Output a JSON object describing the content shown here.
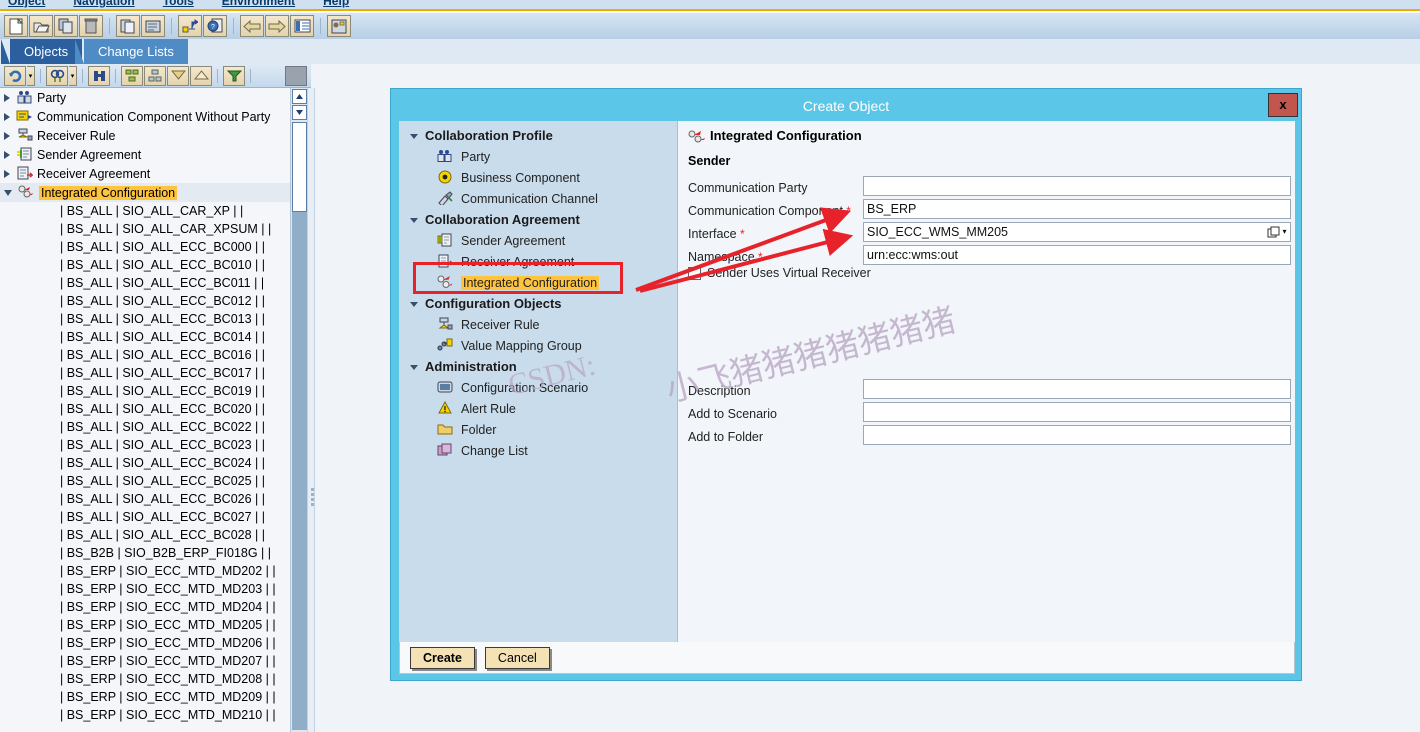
{
  "menu": {
    "items": [
      "Object",
      "Navigation",
      "Tools",
      "Environment",
      "Help"
    ]
  },
  "toolbar": {
    "icons": [
      "new-document-icon",
      "open-folder-icon",
      "copy-icon",
      "delete-trash-icon",
      "duplicate-icon",
      "properties-icon",
      "where-used-icon",
      "find-object-icon",
      "back-arrow-icon",
      "forward-arrow-icon",
      "list-view-icon",
      "user-admin-icon"
    ]
  },
  "tabs": {
    "objects": "Objects",
    "change_lists": "Change Lists"
  },
  "subtoolbar": {
    "icons": [
      "refresh-icon",
      "find-icon",
      "binoculars-icon",
      "expand-tree-icon",
      "collapse-tree-icon",
      "expand-all-icon",
      "collapse-all-icon",
      "filter-icon",
      "stop-icon"
    ]
  },
  "tree": {
    "roots": [
      {
        "label": "Party",
        "icon": "party-icon",
        "expanded": false,
        "highlighted": false
      },
      {
        "label": "Communication Component Without Party",
        "icon": "communication-component-icon",
        "expanded": false,
        "highlighted": false
      },
      {
        "label": "Receiver Rule",
        "icon": "receiver-rule-icon",
        "expanded": false,
        "highlighted": false
      },
      {
        "label": "Sender Agreement",
        "icon": "sender-agreement-icon",
        "expanded": false,
        "highlighted": false
      },
      {
        "label": "Receiver Agreement",
        "icon": "receiver-agreement-icon",
        "expanded": false,
        "highlighted": false
      },
      {
        "label": "Integrated Configuration",
        "icon": "integrated-configuration-icon",
        "expanded": true,
        "highlighted": true
      }
    ],
    "leaves": [
      "| BS_ALL | SIO_ALL_CAR_XP | |",
      "| BS_ALL | SIO_ALL_CAR_XPSUM | |",
      "| BS_ALL | SIO_ALL_ECC_BC000 | |",
      "| BS_ALL | SIO_ALL_ECC_BC010 | |",
      "| BS_ALL | SIO_ALL_ECC_BC011 | |",
      "| BS_ALL | SIO_ALL_ECC_BC012 | |",
      "| BS_ALL | SIO_ALL_ECC_BC013 | |",
      "| BS_ALL | SIO_ALL_ECC_BC014 | |",
      "| BS_ALL | SIO_ALL_ECC_BC016 | |",
      "| BS_ALL | SIO_ALL_ECC_BC017 | |",
      "| BS_ALL | SIO_ALL_ECC_BC019 | |",
      "| BS_ALL | SIO_ALL_ECC_BC020 | |",
      "| BS_ALL | SIO_ALL_ECC_BC022 | |",
      "| BS_ALL | SIO_ALL_ECC_BC023 | |",
      "| BS_ALL | SIO_ALL_ECC_BC024 | |",
      "| BS_ALL | SIO_ALL_ECC_BC025 | |",
      "| BS_ALL | SIO_ALL_ECC_BC026 | |",
      "| BS_ALL | SIO_ALL_ECC_BC027 | |",
      "| BS_ALL | SIO_ALL_ECC_BC028 | |",
      "| BS_B2B | SIO_B2B_ERP_FI018G | |",
      "| BS_ERP | SIO_ECC_MTD_MD202 | |",
      "| BS_ERP | SIO_ECC_MTD_MD203 | |",
      "| BS_ERP | SIO_ECC_MTD_MD204 | |",
      "| BS_ERP | SIO_ECC_MTD_MD205 | |",
      "| BS_ERP | SIO_ECC_MTD_MD206 | |",
      "| BS_ERP | SIO_ECC_MTD_MD207 | |",
      "| BS_ERP | SIO_ECC_MTD_MD208 | |",
      "| BS_ERP | SIO_ECC_MTD_MD209 | |",
      "| BS_ERP | SIO_ECC_MTD_MD210 | |"
    ]
  },
  "dialog": {
    "title": "Create Object",
    "close_label": "x",
    "tree": [
      {
        "type": "group",
        "label": "Collaboration Profile",
        "icon": "chevron-down-icon"
      },
      {
        "type": "item",
        "label": "Party",
        "icon": "party-icon"
      },
      {
        "type": "item",
        "label": "Business Component",
        "icon": "business-component-icon"
      },
      {
        "type": "item",
        "label": "Communication Channel",
        "icon": "communication-channel-icon"
      },
      {
        "type": "group",
        "label": "Collaboration Agreement",
        "icon": "chevron-down-icon"
      },
      {
        "type": "item",
        "label": "Sender Agreement",
        "icon": "sender-agreement-icon"
      },
      {
        "type": "item",
        "label": "Receiver Agreement",
        "icon": "receiver-agreement-icon"
      },
      {
        "type": "item",
        "label": "Integrated Configuration",
        "icon": "integrated-configuration-icon",
        "selected": true
      },
      {
        "type": "group",
        "label": "Configuration Objects",
        "icon": "chevron-down-icon"
      },
      {
        "type": "item",
        "label": "Receiver Rule",
        "icon": "receiver-rule-icon"
      },
      {
        "type": "item",
        "label": "Value Mapping Group",
        "icon": "value-mapping-group-icon"
      },
      {
        "type": "group",
        "label": "Administration",
        "icon": "chevron-down-icon"
      },
      {
        "type": "item",
        "label": "Configuration Scenario",
        "icon": "configuration-scenario-icon"
      },
      {
        "type": "item",
        "label": "Alert Rule",
        "icon": "alert-rule-icon"
      },
      {
        "type": "item",
        "label": "Folder",
        "icon": "folder-icon"
      },
      {
        "type": "item",
        "label": "Change List",
        "icon": "change-list-icon"
      }
    ],
    "form": {
      "heading": "Integrated Configuration",
      "section": "Sender",
      "fields": [
        {
          "label": "Communication Party",
          "required": false,
          "value": "",
          "has_lov": false
        },
        {
          "label": "Communication Component",
          "required": true,
          "value": "BS_ERP",
          "has_lov": false
        },
        {
          "label": "Interface",
          "required": true,
          "value": "SIO_ECC_WMS_MM205",
          "has_lov": true
        },
        {
          "label": "Namespace",
          "required": true,
          "value": "urn:ecc:wms:out",
          "has_lov": false
        }
      ],
      "checkbox_label": "Sender Uses Virtual Receiver",
      "checkbox_checked": false,
      "bottom_fields": [
        {
          "label": "Description",
          "value": ""
        },
        {
          "label": "Add to Scenario",
          "value": ""
        },
        {
          "label": "Add to Folder",
          "value": ""
        }
      ]
    },
    "buttons": {
      "create": "Create",
      "cancel": "Cancel"
    }
  },
  "annotations": {
    "highlight_box_target": "Integrated Configuration",
    "arrow_color": "#e8222a",
    "arrow_count": 2
  },
  "watermarks": {
    "csdn": "CSDN:",
    "nickname": "小飞猪猪猪猪猪猪猪"
  },
  "colors": {
    "dialog_frame": "#5bc6e8",
    "highlight": "#ffc33c",
    "accent_red": "#e8222a",
    "tab_active": "#2b5f9e"
  }
}
